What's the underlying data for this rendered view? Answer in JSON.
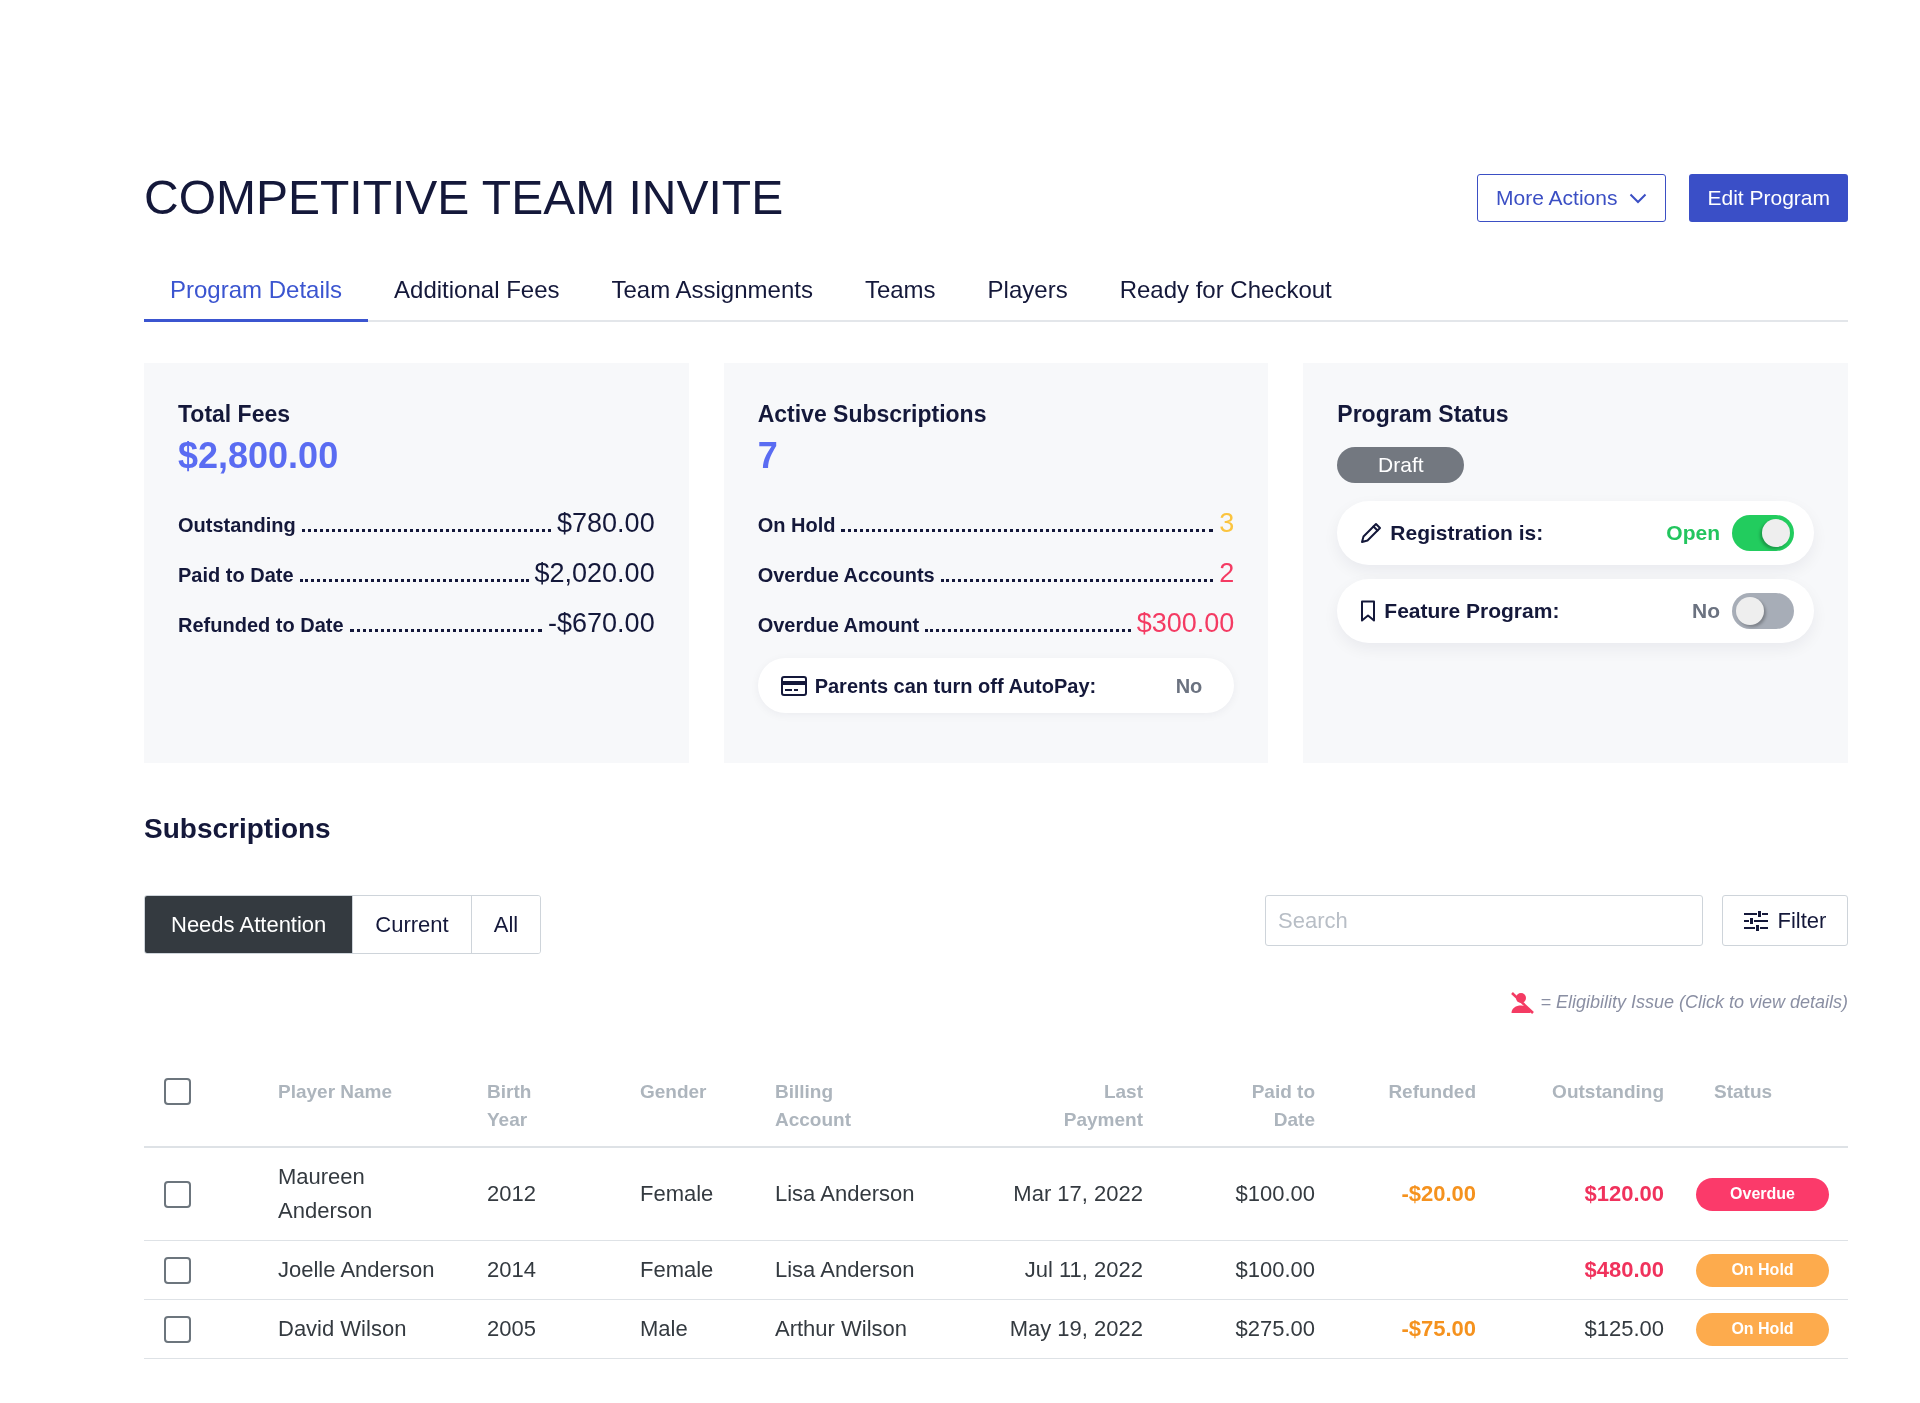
{
  "page": {
    "title": "COMPETITIVE TEAM INVITE"
  },
  "header_buttons": [
    {
      "label": "More Actions",
      "kind": "dropdown"
    },
    {
      "label": "Edit Program",
      "kind": "primary"
    }
  ],
  "tabs": [
    {
      "label": "Program Details",
      "selected": true
    },
    {
      "label": "Additional Fees",
      "selected": false
    },
    {
      "label": "Team Assignments",
      "selected": false
    },
    {
      "label": "Teams",
      "selected": false
    },
    {
      "label": "Players",
      "selected": false
    },
    {
      "label": "Ready for Checkout",
      "selected": false
    }
  ],
  "summary_cards": [
    {
      "kind": "totals",
      "title": "Total Fees",
      "value": "$2,800.00",
      "rows": [
        {
          "label": "Outstanding",
          "value": "$780.00"
        },
        {
          "label": "Paid to Date",
          "value": "$2,020.00"
        },
        {
          "label": "Refunded to Date",
          "value": "-$670.00"
        }
      ]
    },
    {
      "kind": "totals",
      "title": "Active Subscriptions",
      "value": "7",
      "rows": [
        {
          "label": "On Hold",
          "value": "3",
          "color": "#fbc43f"
        },
        {
          "label": "Overdue Accounts",
          "value": "2",
          "color": "#f43b63"
        },
        {
          "label": "Overdue Amount",
          "value": "$300.00",
          "color": "#f43b63"
        }
      ],
      "setting": {
        "label": "Parents can turn off AutoPay:",
        "value": "No"
      }
    },
    {
      "kind": "status",
      "title": "Program Status",
      "badge": "Draft",
      "toggles": [
        {
          "label": "Registration is:",
          "value": "Open",
          "on": true
        },
        {
          "label": "Feature Program:",
          "value": "No",
          "on": false
        }
      ]
    }
  ],
  "subscriptions": {
    "title": "Subscriptions",
    "filters": [
      {
        "label": "Needs Attention",
        "selected": true
      },
      {
        "label": "Current",
        "selected": false
      },
      {
        "label": "All",
        "selected": false
      }
    ],
    "search": {
      "placeholder": "Search"
    },
    "filter_button": "Filter",
    "legend": "= Eligibility Issue (Click to view details)",
    "table": {
      "select_all": {
        "checked": false
      },
      "columns": [
        "Player Name",
        "Birth Year",
        "Gender",
        "Billing Account",
        "Last Payment",
        "Paid to Date",
        "Refunded",
        "Outstanding",
        "Status"
      ],
      "rows": [
        {
          "checked": false,
          "player_name": "Maureen Anderson",
          "birth_year": "2012",
          "gender": "Female",
          "billing_account": "Lisa Anderson",
          "last_payment": "Mar 17, 2022",
          "paid_to_date": "$100.00",
          "refunded": "-$20.00",
          "outstanding": "$120.00",
          "outstanding_alert": true,
          "status": {
            "label": "Overdue",
            "color": "#fb3a6a"
          }
        },
        {
          "checked": false,
          "player_name": "Joelle Anderson",
          "birth_year": "2014",
          "gender": "Female",
          "billing_account": "Lisa Anderson",
          "last_payment": "Jul 11, 2022",
          "paid_to_date": "$100.00",
          "outstanding": "$480.00",
          "outstanding_alert": true,
          "status": {
            "label": "On Hold",
            "color": "#fdab4d"
          }
        },
        {
          "checked": false,
          "player_name": "David Wilson",
          "birth_year": "2005",
          "gender": "Male",
          "billing_account": "Arthur Wilson",
          "last_payment": "May 19, 2022",
          "paid_to_date": "$275.00",
          "refunded": "-$75.00",
          "outstanding": "$125.00",
          "outstanding_alert": false,
          "status": {
            "label": "On Hold",
            "color": "#fdab4d"
          }
        }
      ]
    }
  }
}
